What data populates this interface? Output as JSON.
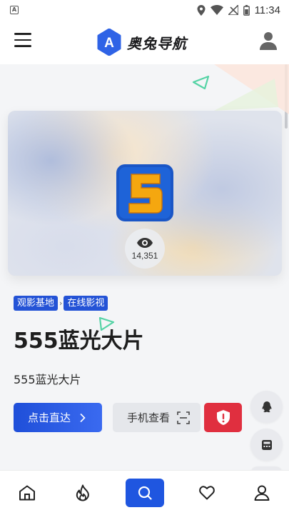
{
  "status_bar": {
    "time": "11:34",
    "app_icon_letter": "A",
    "icons": [
      "location-icon",
      "wifi-icon",
      "no-signal-icon",
      "battery-icon"
    ]
  },
  "header": {
    "logo_letter": "A",
    "brand_name": "奥兔导航",
    "menu_icon": "menu-icon",
    "user_icon": "user-icon"
  },
  "hero": {
    "app_icon": "app-5-icon",
    "app_icon_glyph": "5",
    "views_icon": "eye-icon",
    "views_count": "14,351"
  },
  "breadcrumb": {
    "items": [
      "观影基地",
      "在线影视"
    ],
    "separator": "›"
  },
  "site": {
    "title": "555蓝光大片",
    "description": "555蓝光大片"
  },
  "actions": {
    "go_label": "点击直达",
    "mobile_label": "手机查看",
    "report_icon": "shield-icon"
  },
  "floating": [
    "qq-icon",
    "calculator-icon"
  ],
  "bottom_nav": [
    "home-icon",
    "fire-icon",
    "search-icon",
    "heart-icon",
    "profile-icon"
  ],
  "colors": {
    "accent": "#1f56e0",
    "danger": "#e02f3f",
    "crumb_bg": "#2453d6"
  }
}
